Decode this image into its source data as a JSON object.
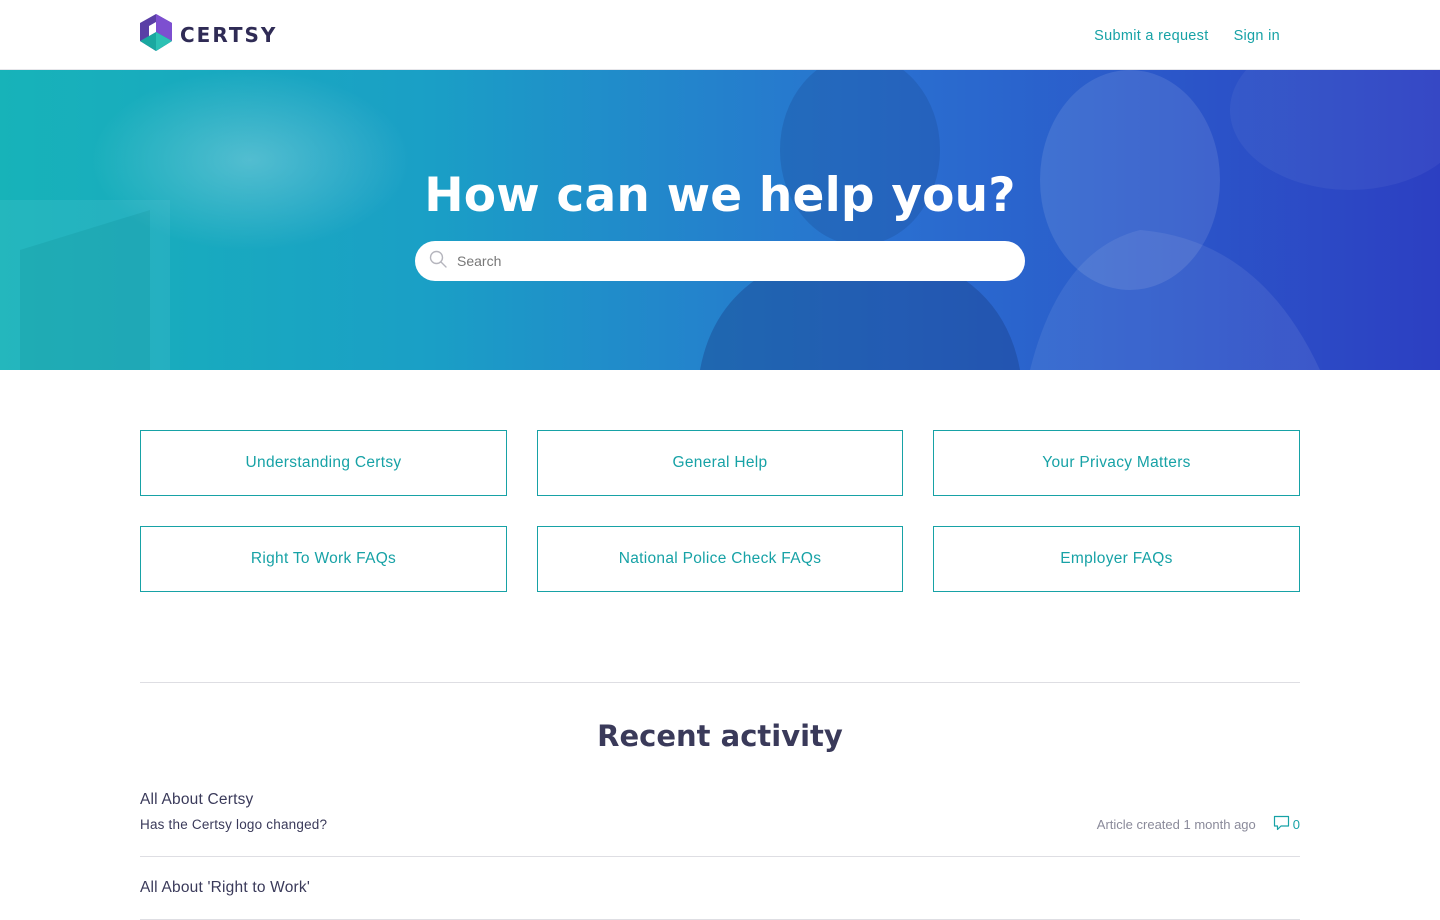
{
  "header": {
    "brand": "CERTSY",
    "nav": {
      "submit_request": "Submit a request",
      "sign_in": "Sign in"
    }
  },
  "hero": {
    "title": "How can we help you?",
    "search_placeholder": "Search"
  },
  "categories": [
    "Understanding Certsy",
    "General Help",
    "Your Privacy Matters",
    "Right To Work FAQs",
    "National Police Check FAQs",
    "Employer FAQs"
  ],
  "recent": {
    "title": "Recent activity",
    "items": [
      {
        "section": "All About Certsy",
        "article": "Has the Certsy logo changed?",
        "meta": "Article created 1 month ago",
        "comments": "0"
      },
      {
        "section": "All About 'Right to Work'"
      }
    ]
  },
  "colors": {
    "accent": "#17a2a6",
    "brand_text": "#2f2b55",
    "hero_start": "#17b3b9",
    "hero_end": "#2c3fc2"
  },
  "icons": {
    "logo": "certsy-hexagon-logo-icon",
    "search": "search-icon",
    "comment": "comment-bubble-icon"
  }
}
